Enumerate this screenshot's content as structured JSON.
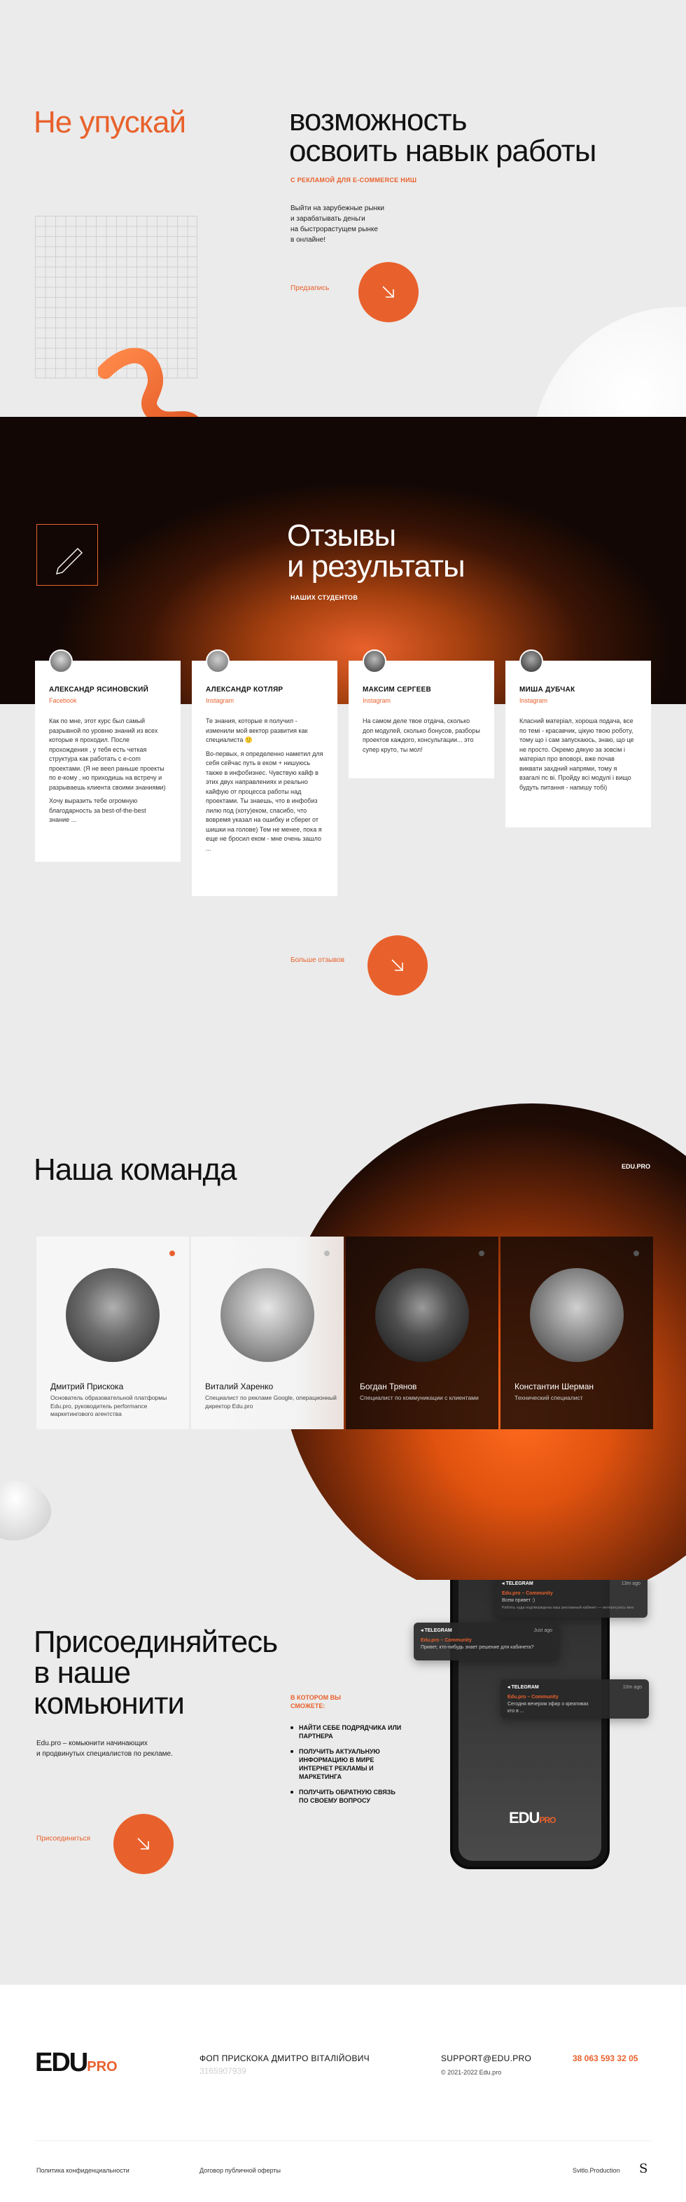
{
  "hero": {
    "title_left": "Не упускай",
    "title_right_line1": "возможность",
    "title_right_line2": "освоить навык работы",
    "subtitle": "С РЕКЛАМОЙ ДЛЯ E-COMMERCE НИШ",
    "desc_line1": "Выйти на зарубежные рынки",
    "desc_line2": "и зарабатывать деньги",
    "desc_line3": "на быстрорастущем рынке",
    "desc_line4": "в онлайне!",
    "cta_label": "Предзапись"
  },
  "reviews": {
    "title_line1": "Отзывы",
    "title_line2": "и результаты",
    "subtitle": "НАШИХ СТУДЕНТОВ",
    "more_label": "Больше отзывов",
    "items": [
      {
        "name": "АЛЕКСАНДР ЯСИНОВСКИЙ",
        "source": "Facebook",
        "p1": "Как по мне, этот курс был самый разрывной по уровню знаний из всех которые я проходил. После прохождения , у тебя есть четкая структура как работать с e-com проектами. (Я не веел раньше проекты по е-кому , но приходишь на встречу и разрываешь клиента своими знаниями)",
        "p2": "Хочу выразить тебе огромную благодарность за best-of-the-best знание ..."
      },
      {
        "name": "АЛЕКСАНДР КОТЛЯР",
        "source": "Instagram",
        "p1": "Те знания, которые я получил - изменили мой вектор развития как специалиста 🙂",
        "p2": "Во-первых, я определенно наметил для себя сейчас путь в еком + нишуюсь также в инфобизнес. Чувствую кайф в этих двух направлениях и реально кайфую от процесса работы над проектами. Ты знаешь, что в инфобиз лилю под (хоту)еком, спасибо, что вовремя указал на ошибку и сбереr от шишки на голове) Тем не менее, пока я еще не бросил еком - мне очень зашло ..."
      },
      {
        "name": "МАКСИМ СЕРГЕЕВ",
        "source": "Instagram",
        "p1": "На самом деле твое отдача, сколько доп модулей, сколько бонусов, разборы проектов каждого, консультации... это супер круто, ты мол!",
        "p2": ""
      },
      {
        "name": "МИША ДУБЧАК",
        "source": "Instagram",
        "p1": "Класний матеріал, хороша подача, все по темі - красавчик, цікую твою роботу, тому що і сам запускаюсь, знаю, що це не просто. Окремо дякую за зовсім і матеріал про вповорі, вже почав виквати захдний напрями, тому я взагалі пс ві. Пройду всі модулі і вищо будуть питання - напишу тобі)",
        "p2": ""
      }
    ]
  },
  "team": {
    "title": "Наша команда",
    "brand": "EDU.PRO",
    "members": [
      {
        "name": "Дмитрий Прискока",
        "role": "Основатель образовательной платформы Edu.pro, руководитель performance маркетингового агентства"
      },
      {
        "name": "Виталий Харенко",
        "role": "Специалист по рекламе Google, операционный директор Edu.pro"
      },
      {
        "name": "Богдан Трянов",
        "role": "Специалист по коммуникации с клиентами"
      },
      {
        "name": "Константин Шерман",
        "role": "Технический специалист"
      }
    ]
  },
  "community": {
    "title_line1": "Присоединяйтесь",
    "title_line2": "в наше",
    "title_line3": "комьюнити",
    "desc_line1": "Edu.pro – комьюнити начинающих",
    "desc_line2": "и продвинутых специалистов по рекламе.",
    "sub_line1": "В КОТОРОМ ВЫ",
    "sub_line2": "СМОЖЕТЕ:",
    "benefits": [
      "НАЙТИ СЕБЕ ПОДРЯДЧИКА ИЛИ ПАРТНЕРА",
      "ПОЛУЧИТЬ АКТУАЛЬНУЮ ИНФОРМАЦИЮ В МИРЕ ИНТЕРНЕТ РЕКЛАМЫ И МАРКЕТИНГА",
      "ПОЛУЧИТЬ ОБРАТНУЮ СВЯЗЬ ПО СВОЕМУ ВОПРОСУ"
    ],
    "cta_label": "Присоединиться",
    "phone_logo": "EDU",
    "phone_logo_suffix": "PRO",
    "notifications": [
      {
        "app": "TELEGRAM",
        "time": "13m ago",
        "title": "Edu.pro – Community",
        "body": "Всем привет :)",
        "extra": "Работа, куда подтверждены ваш рекламный кабинет — интересуюсь мне"
      },
      {
        "app": "TELEGRAM",
        "time": "Just ago",
        "title": "Edu.pro – Community",
        "body": "Привет, кто-нибудь знает решение для кабинета?"
      },
      {
        "app": "TELEGRAM",
        "time": "10m ago",
        "title": "Edu.pro – Community",
        "body": "Сегодня вечером эфир о креативах",
        "extra": "кто в ..."
      }
    ]
  },
  "footer": {
    "logo": "EDU",
    "logo_suffix": "PRO",
    "company": "ФОП ПРИСКОКА ДМИТРО ВІТАЛІЙОВИЧ",
    "company_code": "3165907939",
    "email": "SUPPORT@EDU.PRO",
    "copyright": "© 2021-2022 Edu.pro",
    "phone": "38 063 593 32 05",
    "privacy": "Политика конфиденциальности",
    "offer": "Договор публичной оферты",
    "studio": "Svitlo.Production",
    "studio_mark": "S"
  },
  "colors": {
    "accent": "#e8612c",
    "dark": "#120704",
    "bg": "#ededed"
  }
}
